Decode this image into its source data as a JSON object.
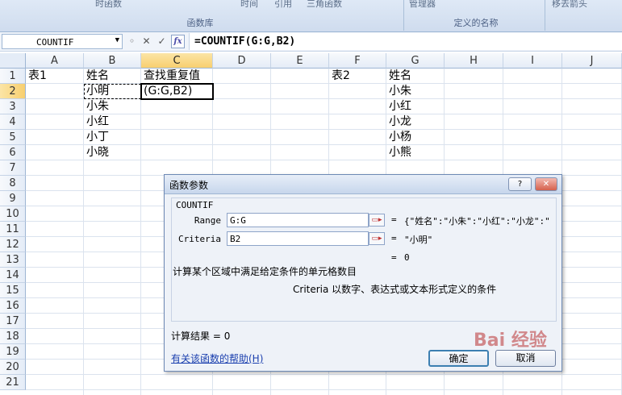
{
  "ribbon": {
    "items": [
      "时函数",
      "时间",
      "引用",
      "三角函数",
      "管理器",
      "移去箭头"
    ],
    "groups": [
      "函数库",
      "定义的名称"
    ]
  },
  "formula_bar": {
    "name_box": "COUNTIF",
    "cancel_glyph": "✕",
    "enter_glyph": "✓",
    "fx_label": "fx",
    "formula": "=COUNTIF(G:G,B2)"
  },
  "sheet": {
    "columns": [
      "A",
      "B",
      "C",
      "D",
      "E",
      "F",
      "G",
      "H",
      "I",
      "J"
    ],
    "rows": [
      "1",
      "2",
      "3",
      "4",
      "5",
      "6",
      "7",
      "8",
      "9",
      "10",
      "11",
      "12",
      "13",
      "14",
      "15",
      "16",
      "17",
      "18",
      "19",
      "20",
      "21"
    ],
    "selected_column": "C",
    "selected_row": "2",
    "cells": {
      "A1": "表1",
      "B1": "姓名",
      "C1": "查找重复值",
      "F1": "表2",
      "G1": "姓名",
      "B2": "小明",
      "C2": "(G:G,B2)",
      "B3": "小朱",
      "B4": "小红",
      "B5": "小丁",
      "B6": "小晓",
      "G2": "小朱",
      "G3": "小红",
      "G4": "小龙",
      "G5": "小杨",
      "G6": "小熊"
    }
  },
  "dialog": {
    "title": "函数参数",
    "help_button": "?",
    "close_button": "✕",
    "function_name": "COUNTIF",
    "range_label": "Range",
    "range_value": "G:G",
    "range_result": "{\"姓名\":\"小朱\":\"小红\":\"小龙\":\"",
    "criteria_label": "Criteria",
    "criteria_value": "B2",
    "criteria_result": "\"小明\"",
    "equals": "=",
    "function_result": "0",
    "description": "计算某个区域中满足给定条件的单元格数目",
    "arg_description": "Criteria  以数字、表达式或文本形式定义的条件",
    "calc_result_label": "计算结果 = ",
    "calc_result_value": "0",
    "help_link": "有关该函数的帮助(H)",
    "ok_button": "确定",
    "cancel_button": "取消"
  },
  "watermark": "Bai 经验"
}
